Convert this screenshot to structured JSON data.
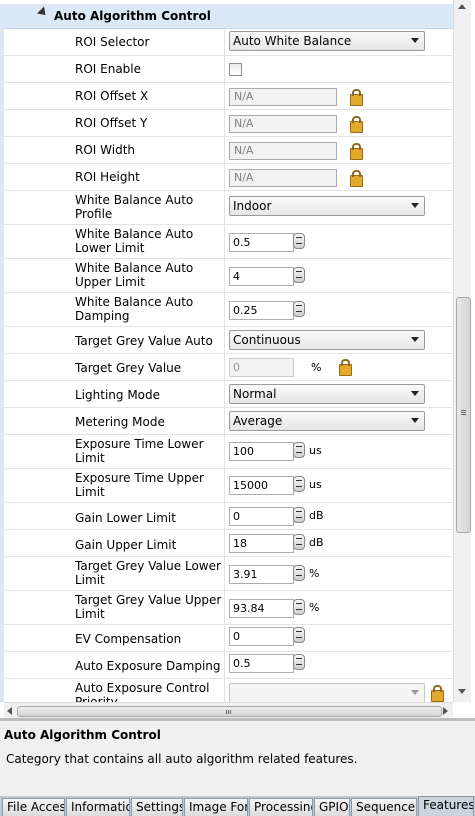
{
  "category": {
    "title": "Auto Algorithm Control"
  },
  "rows": [
    {
      "label": "ROI Selector",
      "value": "Auto White Balance"
    },
    {
      "label": "ROI Enable"
    },
    {
      "label": "ROI Offset X",
      "value": "N/A"
    },
    {
      "label": "ROI Offset Y",
      "value": "N/A"
    },
    {
      "label": "ROI Width",
      "value": "N/A"
    },
    {
      "label": "ROI Height",
      "value": "N/A"
    },
    {
      "label": "White Balance Auto Profile",
      "value": "Indoor"
    },
    {
      "label": "White Balance Auto Lower Limit",
      "value": "0.5"
    },
    {
      "label": "White Balance Auto Upper Limit",
      "value": "4"
    },
    {
      "label": "White Balance Auto Damping",
      "value": "0.25"
    },
    {
      "label": "Target Grey Value Auto",
      "value": "Continuous"
    },
    {
      "label": "Target Grey Value",
      "value": "0",
      "unit": "%"
    },
    {
      "label": "Lighting Mode",
      "value": "Normal"
    },
    {
      "label": "Metering Mode",
      "value": "Average"
    },
    {
      "label": "Exposure Time Lower Limit",
      "value": "100",
      "unit": "us"
    },
    {
      "label": "Exposure Time Upper Limit",
      "value": "15000",
      "unit": "us"
    },
    {
      "label": "Gain Lower Limit",
      "value": "0",
      "unit": "dB"
    },
    {
      "label": "Gain Upper Limit",
      "value": "18",
      "unit": "dB"
    },
    {
      "label": "Target Grey Value Lower Limit",
      "value": "3.91",
      "unit": "%"
    },
    {
      "label": "Target Grey Value Upper Limit",
      "value": "93.84",
      "unit": "%"
    },
    {
      "label": "EV Compensation",
      "value": "0"
    },
    {
      "label": "Auto Exposure Damping",
      "value": "0.5"
    },
    {
      "label": "Auto Exposure Control Priority",
      "value": ""
    }
  ],
  "info": {
    "title": "Auto Algorithm Control",
    "description": "Category that contains all auto algorithm related features."
  },
  "tabs": [
    "File Access",
    "Informatio",
    "Settings",
    "Image For",
    "Processing",
    "GPIO",
    "Sequencer",
    "Features"
  ],
  "active_tab": "Features",
  "icons": {
    "lock": "lock-icon",
    "spin": "spin-button-icon",
    "dropdown": "chevron-down-icon"
  }
}
